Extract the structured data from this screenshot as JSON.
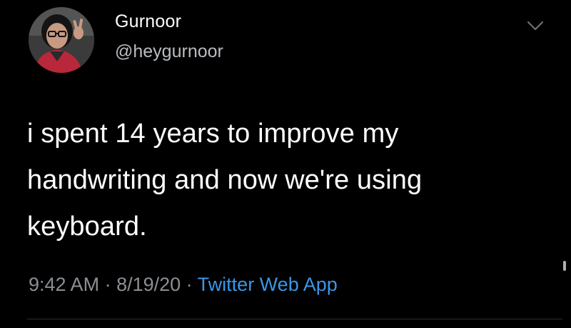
{
  "tweet": {
    "author": {
      "display_name": "Gurnoor",
      "handle": "@heygurnoor",
      "avatar_icon": "profile-photo-avatar"
    },
    "menu_icon": "chevron-down-icon",
    "text_lines": [
      "i spent 14 years to improve my",
      "handwriting and now we're using",
      "keyboard."
    ],
    "meta": {
      "time": "9:42 AM",
      "separator": " · ",
      "date": "8/19/20",
      "source": "Twitter Web App"
    }
  },
  "colors": {
    "background": "#000000",
    "primary_text": "#ffffff",
    "secondary_text": "#8b8f94",
    "link": "#3a96e8"
  }
}
